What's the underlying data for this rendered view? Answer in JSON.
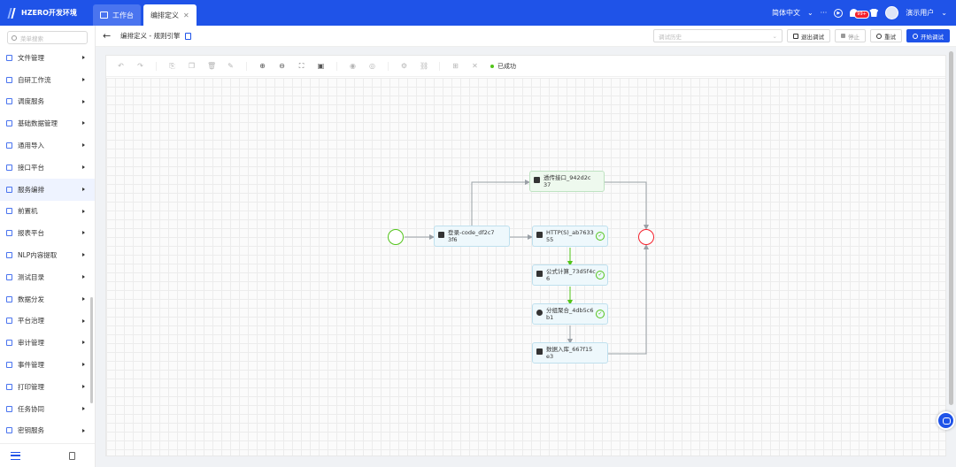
{
  "app": {
    "title": "HZERO开发环境"
  },
  "tabs": [
    {
      "label": "工作台"
    },
    {
      "label": "编排定义"
    }
  ],
  "topbar": {
    "language": "简体中文",
    "more": "···",
    "badge": "99+",
    "user": "演示用户"
  },
  "sidebar": {
    "search_placeholder": "菜单搜索",
    "items": [
      {
        "label": "文件管理"
      },
      {
        "label": "自研工作流"
      },
      {
        "label": "调度服务"
      },
      {
        "label": "基础数据管理"
      },
      {
        "label": "通用导入"
      },
      {
        "label": "接口平台"
      },
      {
        "label": "服务编排"
      },
      {
        "label": "前置机"
      },
      {
        "label": "报表平台"
      },
      {
        "label": "NLP内容提取"
      },
      {
        "label": "测试目录"
      },
      {
        "label": "数据分发"
      },
      {
        "label": "平台治理"
      },
      {
        "label": "审计管理"
      },
      {
        "label": "事件管理"
      },
      {
        "label": "打印管理"
      },
      {
        "label": "任务协同"
      },
      {
        "label": "密钥服务"
      }
    ]
  },
  "header": {
    "title": "编排定义 - 规则引擎",
    "select_placeholder": "调试历史",
    "exit_debug": "退出调试",
    "stop": "停止",
    "retry": "重试",
    "start_debug": "开始调试"
  },
  "toolbar": {
    "status": "已成功"
  },
  "flow": {
    "nodes": [
      {
        "id": "login",
        "label": "登录-code_df2c73f6"
      },
      {
        "id": "upload",
        "label": "透传接口_942d2c37"
      },
      {
        "id": "http",
        "label": "HTTP(S)_ab763355"
      },
      {
        "id": "formula",
        "label": "公式计算_73d5f4c6"
      },
      {
        "id": "group",
        "label": "分组聚合_4db5c6b1"
      },
      {
        "id": "store",
        "label": "数据入库_667f15e3"
      }
    ]
  },
  "colors": {
    "primary": "#1f53e8",
    "success": "#52c41a",
    "danger": "#f5222d"
  }
}
